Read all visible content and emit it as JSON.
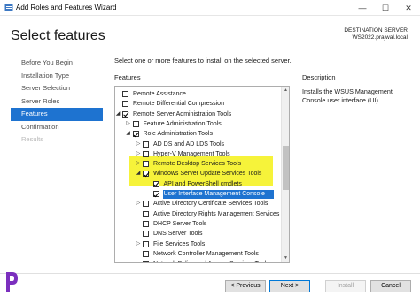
{
  "window": {
    "title": "Add Roles and Features Wizard",
    "minimize": "—",
    "maximize": "☐",
    "close": "✕"
  },
  "header": {
    "page_title": "Select features",
    "destination_label": "DESTINATION SERVER",
    "destination_value": "WS2022.prajwal.local"
  },
  "sidebar": {
    "items": [
      {
        "label": "Before You Begin",
        "state": "normal"
      },
      {
        "label": "Installation Type",
        "state": "normal"
      },
      {
        "label": "Server Selection",
        "state": "normal"
      },
      {
        "label": "Server Roles",
        "state": "normal"
      },
      {
        "label": "Features",
        "state": "active"
      },
      {
        "label": "Confirmation",
        "state": "normal"
      },
      {
        "label": "Results",
        "state": "disabled"
      }
    ]
  },
  "main": {
    "intro": "Select one or more features to install on the selected server.",
    "features_label": "Features",
    "description_label": "Description",
    "description_text": "Installs the WSUS Management Console user interface (UI)."
  },
  "tree": [
    {
      "label": "Remote Assistance",
      "indent": 0,
      "checked": false,
      "expander": ""
    },
    {
      "label": "Remote Differential Compression",
      "indent": 0,
      "checked": false,
      "expander": ""
    },
    {
      "label": "Remote Server Administration Tools",
      "indent": 0,
      "checked": true,
      "expander": "◢"
    },
    {
      "label": "Feature Administration Tools",
      "indent": 1,
      "checked": false,
      "expander": "▷"
    },
    {
      "label": "Role Administration Tools",
      "indent": 1,
      "checked": true,
      "expander": "◢"
    },
    {
      "label": "AD DS and AD LDS Tools",
      "indent": 2,
      "checked": false,
      "expander": "▷"
    },
    {
      "label": "Hyper-V Management Tools",
      "indent": 2,
      "checked": false,
      "expander": "▷"
    },
    {
      "label": "Remote Desktop Services Tools",
      "indent": 2,
      "checked": false,
      "expander": "▷"
    },
    {
      "label": "Windows Server Update Services Tools",
      "indent": 2,
      "checked": true,
      "expander": "◢"
    },
    {
      "label": "API and PowerShell cmdlets",
      "indent": 3,
      "checked": true,
      "expander": ""
    },
    {
      "label": "User Interface Management Console",
      "indent": 3,
      "checked": true,
      "expander": "",
      "selected": true
    },
    {
      "label": "Active Directory Certificate Services Tools",
      "indent": 2,
      "checked": false,
      "expander": "▷"
    },
    {
      "label": "Active Directory Rights Management Services Tools",
      "indent": 2,
      "checked": false,
      "expander": ""
    },
    {
      "label": "DHCP Server Tools",
      "indent": 2,
      "checked": false,
      "expander": ""
    },
    {
      "label": "DNS Server Tools",
      "indent": 2,
      "checked": false,
      "expander": ""
    },
    {
      "label": "File Services Tools",
      "indent": 2,
      "checked": false,
      "expander": "▷"
    },
    {
      "label": "Network Controller Management Tools",
      "indent": 2,
      "checked": false,
      "expander": ""
    },
    {
      "label": "Network Policy and Access Services Tools",
      "indent": 2,
      "checked": false,
      "expander": ""
    }
  ],
  "buttons": {
    "previous": "< Previous",
    "next": "Next >",
    "install": "Install",
    "cancel": "Cancel"
  },
  "colors": {
    "accent": "#1e73d0",
    "highlight": "#f6f33a",
    "logo": "#7b2fbe"
  },
  "icons": {
    "app": "server-manager-icon",
    "logo": "brand-logo"
  }
}
